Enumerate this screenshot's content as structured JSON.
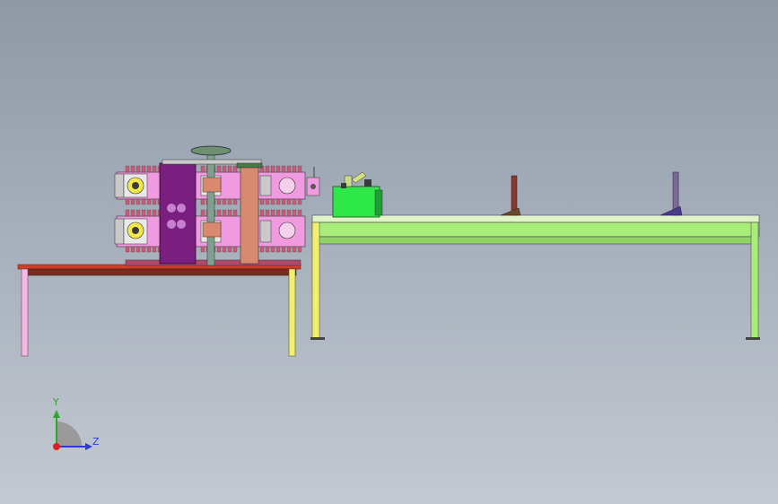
{
  "viewport": {
    "background_top": "#8f99a6",
    "background_bottom": "#c3c9d2"
  },
  "triad": {
    "y_label": "Y",
    "z_label": "Z",
    "y_color": "#2fa52f",
    "z_color": "#2b3bd6",
    "origin_color": "#e02020"
  },
  "colors": {
    "roller_pink": "#f09ae0",
    "purple_plate": "#7a1f7f",
    "salmon_column": "#d98a6e",
    "green_tank": "#2ee84a",
    "conveyor_green": "#a8ec7a",
    "table_top_red": "#d43c28",
    "leg_yellow": "#f2f06a"
  }
}
